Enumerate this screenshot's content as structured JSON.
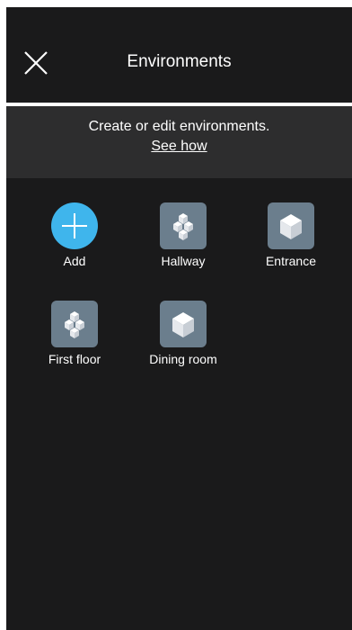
{
  "header": {
    "title": "Environments",
    "close_icon": "close-icon"
  },
  "banner": {
    "text": "Create or edit environments.",
    "link": "See how"
  },
  "environments": [
    {
      "label": "Add",
      "icon": "plus-icon"
    },
    {
      "label": "Hallway",
      "icon": "multi-cube-icon"
    },
    {
      "label": "Entrance",
      "icon": "cube-icon"
    },
    {
      "label": "First floor",
      "icon": "multi-cube-icon"
    },
    {
      "label": "Dining room",
      "icon": "cube-icon"
    }
  ],
  "colors": {
    "background": "#1a1a1b",
    "banner": "#2d2d2e",
    "accent": "#3fb5ec",
    "tile": "#6b7e8d"
  }
}
